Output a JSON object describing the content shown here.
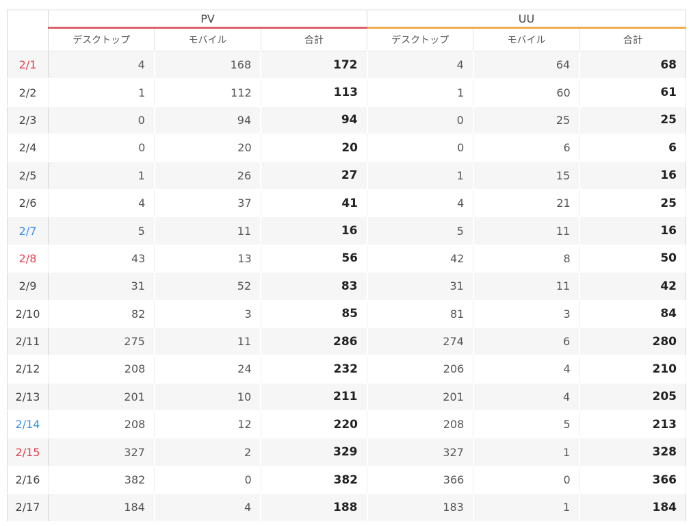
{
  "groups": {
    "pv": "PV",
    "uu": "UU"
  },
  "columns": {
    "pv": [
      "デスクトップ",
      "モバイル",
      "合計"
    ],
    "uu": [
      "デスクトップ",
      "モバイル",
      "合計"
    ]
  },
  "colors": {
    "pv_accent": "#e05f6f",
    "uu_accent": "#f0ad4e",
    "date_red": "#e0404f",
    "date_blue": "#3a8ee6"
  },
  "rows": [
    {
      "date": "2/1",
      "date_color": "red",
      "pv": [
        "4",
        "168",
        "172"
      ],
      "uu": [
        "4",
        "64",
        "68"
      ]
    },
    {
      "date": "2/2",
      "date_color": "",
      "pv": [
        "1",
        "112",
        "113"
      ],
      "uu": [
        "1",
        "60",
        "61"
      ]
    },
    {
      "date": "2/3",
      "date_color": "",
      "pv": [
        "0",
        "94",
        "94"
      ],
      "uu": [
        "0",
        "25",
        "25"
      ]
    },
    {
      "date": "2/4",
      "date_color": "",
      "pv": [
        "0",
        "20",
        "20"
      ],
      "uu": [
        "0",
        "6",
        "6"
      ]
    },
    {
      "date": "2/5",
      "date_color": "",
      "pv": [
        "1",
        "26",
        "27"
      ],
      "uu": [
        "1",
        "15",
        "16"
      ]
    },
    {
      "date": "2/6",
      "date_color": "",
      "pv": [
        "4",
        "37",
        "41"
      ],
      "uu": [
        "4",
        "21",
        "25"
      ]
    },
    {
      "date": "2/7",
      "date_color": "blue",
      "pv": [
        "5",
        "11",
        "16"
      ],
      "uu": [
        "5",
        "11",
        "16"
      ]
    },
    {
      "date": "2/8",
      "date_color": "red",
      "pv": [
        "43",
        "13",
        "56"
      ],
      "uu": [
        "42",
        "8",
        "50"
      ]
    },
    {
      "date": "2/9",
      "date_color": "",
      "pv": [
        "31",
        "52",
        "83"
      ],
      "uu": [
        "31",
        "11",
        "42"
      ]
    },
    {
      "date": "2/10",
      "date_color": "",
      "pv": [
        "82",
        "3",
        "85"
      ],
      "uu": [
        "81",
        "3",
        "84"
      ]
    },
    {
      "date": "2/11",
      "date_color": "",
      "pv": [
        "275",
        "11",
        "286"
      ],
      "uu": [
        "274",
        "6",
        "280"
      ]
    },
    {
      "date": "2/12",
      "date_color": "",
      "pv": [
        "208",
        "24",
        "232"
      ],
      "uu": [
        "206",
        "4",
        "210"
      ]
    },
    {
      "date": "2/13",
      "date_color": "",
      "pv": [
        "201",
        "10",
        "211"
      ],
      "uu": [
        "201",
        "4",
        "205"
      ]
    },
    {
      "date": "2/14",
      "date_color": "blue",
      "pv": [
        "208",
        "12",
        "220"
      ],
      "uu": [
        "208",
        "5",
        "213"
      ]
    },
    {
      "date": "2/15",
      "date_color": "red",
      "pv": [
        "327",
        "2",
        "329"
      ],
      "uu": [
        "327",
        "1",
        "328"
      ]
    },
    {
      "date": "2/16",
      "date_color": "",
      "pv": [
        "382",
        "0",
        "382"
      ],
      "uu": [
        "366",
        "0",
        "366"
      ]
    },
    {
      "date": "2/17",
      "date_color": "",
      "pv": [
        "184",
        "4",
        "188"
      ],
      "uu": [
        "183",
        "1",
        "184"
      ]
    }
  ]
}
